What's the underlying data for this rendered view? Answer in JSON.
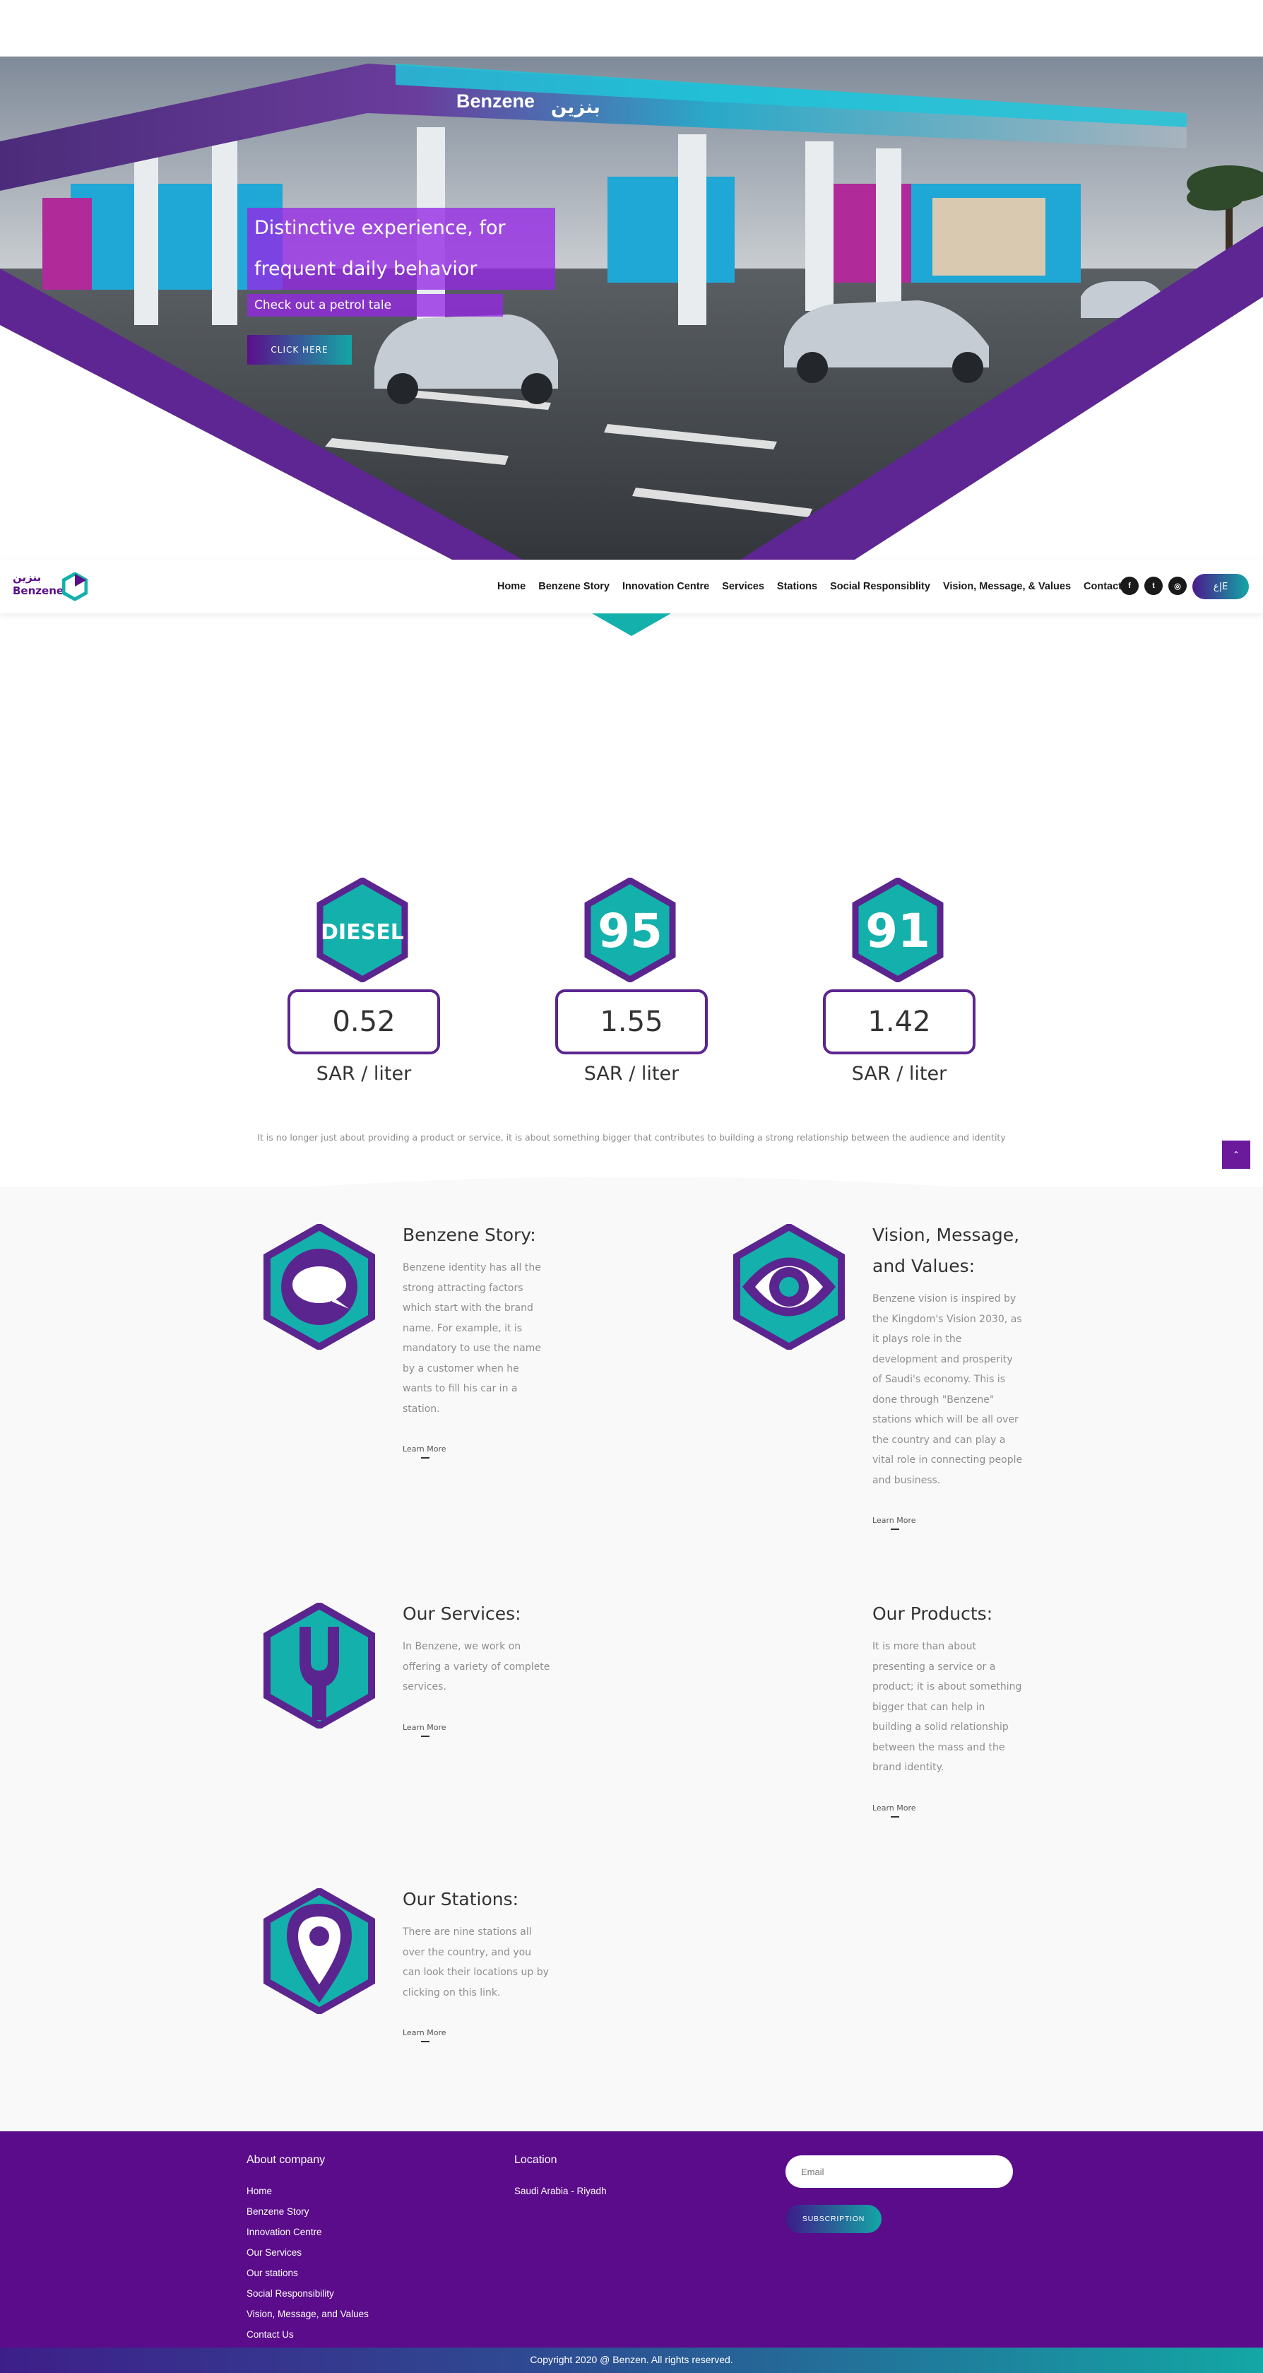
{
  "hero": {
    "title_line1": "Distinctive experience, for",
    "title_line2": "frequent daily behavior",
    "subtitle": "Check out a petrol tale",
    "cta_label": "CLICK HERE",
    "canopy_sign_en": "Benzene",
    "canopy_sign_ar": "بنزين"
  },
  "nav": {
    "brand_en": "Benzene",
    "brand_ar": "بنزين",
    "items": [
      "Home",
      "Benzene Story",
      "Innovation Centre",
      "Services",
      "Stations",
      "Social Responsiblity",
      "Vision, Message, & Values",
      "Contact"
    ],
    "social": [
      {
        "icon": "facebook-icon",
        "glyph": "f"
      },
      {
        "icon": "twitter-icon",
        "glyph": "t"
      },
      {
        "icon": "instagram-icon",
        "glyph": "◎"
      }
    ],
    "language_label": "ع|E"
  },
  "prices": [
    {
      "badge": "DIESEL",
      "value": "0.52",
      "unit": "SAR / liter"
    },
    {
      "badge": "95",
      "value": "1.55",
      "unit": "SAR / liter"
    },
    {
      "badge": "91",
      "value": "1.42",
      "unit": "SAR / liter"
    }
  ],
  "tagline": "It is no longer just about providing a product or service, it is about something bigger that contributes to building a strong relationship between the audience and identity",
  "features": [
    {
      "icon": "chat-bubble-icon",
      "title": "Benzene Story:",
      "text": "Benzene identity has all the strong attracting factors which start with the brand name. For example, it is mandatory to use the name by a customer when he wants to fill his car in a station.",
      "link": "Learn More"
    },
    {
      "icon": "eye-icon",
      "title": "Vision, Message, and Values:",
      "text": "Benzene vision is inspired by the Kingdom's Vision 2030, as it plays role in the development and prosperity of Saudi's economy. This is done through \"Benzene\" stations which will be all over the country and can play a vital role in connecting people and business.",
      "link": "Learn More"
    },
    {
      "icon": "wrench-icon",
      "title": "Our Services:",
      "text": "In Benzene, we work on offering a variety of complete services.",
      "link": "Learn More"
    },
    {
      "icon": "",
      "title": "Our Products:",
      "text": "It is more than about presenting a service or a product; it is about something bigger that can help in building a solid relationship between the mass and the brand identity.",
      "link": "Learn More"
    },
    {
      "icon": "map-pin-icon",
      "title": "Our Stations:",
      "text": "There are nine stations all over the country, and you can look their locations up by clicking on this link.",
      "link": "Learn More"
    }
  ],
  "footer": {
    "about_heading": "About company",
    "links": [
      "Home",
      "Benzene Story",
      "Innovation Centre",
      "Our Services",
      "Our stations",
      "Social Responsibility",
      "Vision, Message, and Values",
      "Contact Us"
    ],
    "location_heading": "Location",
    "location_value": "Saudi Arabia - Riyadh",
    "email_placeholder": "Email",
    "subscribe_label": "SUBSCRIPTION",
    "copyright": "Copyright 2020 @ Benzen. All rights reserved."
  },
  "scroll_top_glyph": "⌃",
  "colors": {
    "purple": "#5a0c8a",
    "teal": "#14b0ab",
    "hex_border": "#5b2590"
  }
}
